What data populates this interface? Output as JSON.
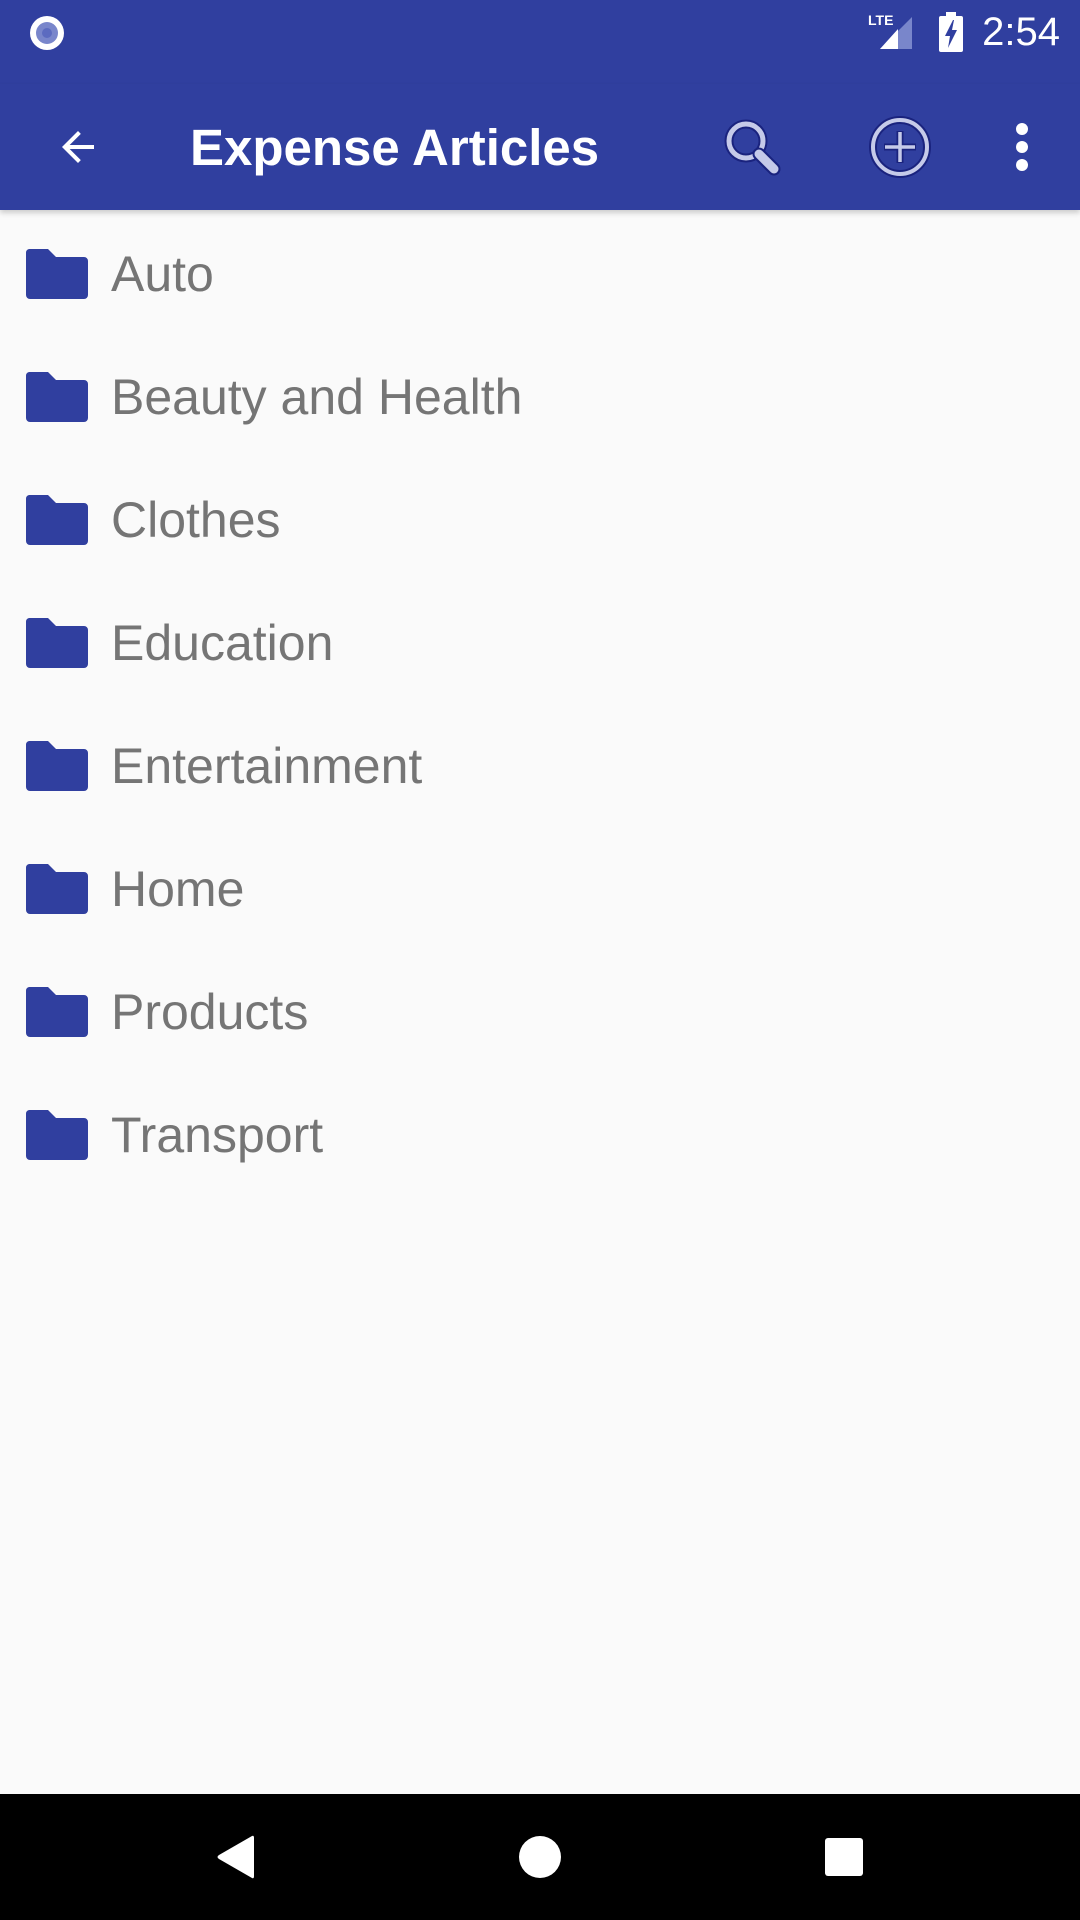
{
  "status_bar": {
    "network_label": "LTE",
    "time": "2:54",
    "icons": [
      "notification-circle-icon",
      "lte-signal-icon",
      "battery-charging-icon"
    ]
  },
  "app_bar": {
    "title": "Expense Articles",
    "back_icon": "arrow-back-icon",
    "actions": [
      {
        "name": "search",
        "icon": "search-icon"
      },
      {
        "name": "add",
        "icon": "add-circle-icon"
      },
      {
        "name": "more",
        "icon": "more-vertical-icon"
      }
    ]
  },
  "list": {
    "item_icon": "folder-icon",
    "items": [
      {
        "label": "Auto"
      },
      {
        "label": "Beauty and Health"
      },
      {
        "label": "Clothes"
      },
      {
        "label": "Education"
      },
      {
        "label": "Entertainment"
      },
      {
        "label": "Home"
      },
      {
        "label": "Products"
      },
      {
        "label": "Transport"
      }
    ]
  },
  "nav_bar": {
    "buttons": [
      "back",
      "home",
      "recents"
    ]
  },
  "colors": {
    "primary": "#303f9f",
    "folder": "#303f9f",
    "item_text": "#757575",
    "background": "#fafafa"
  }
}
